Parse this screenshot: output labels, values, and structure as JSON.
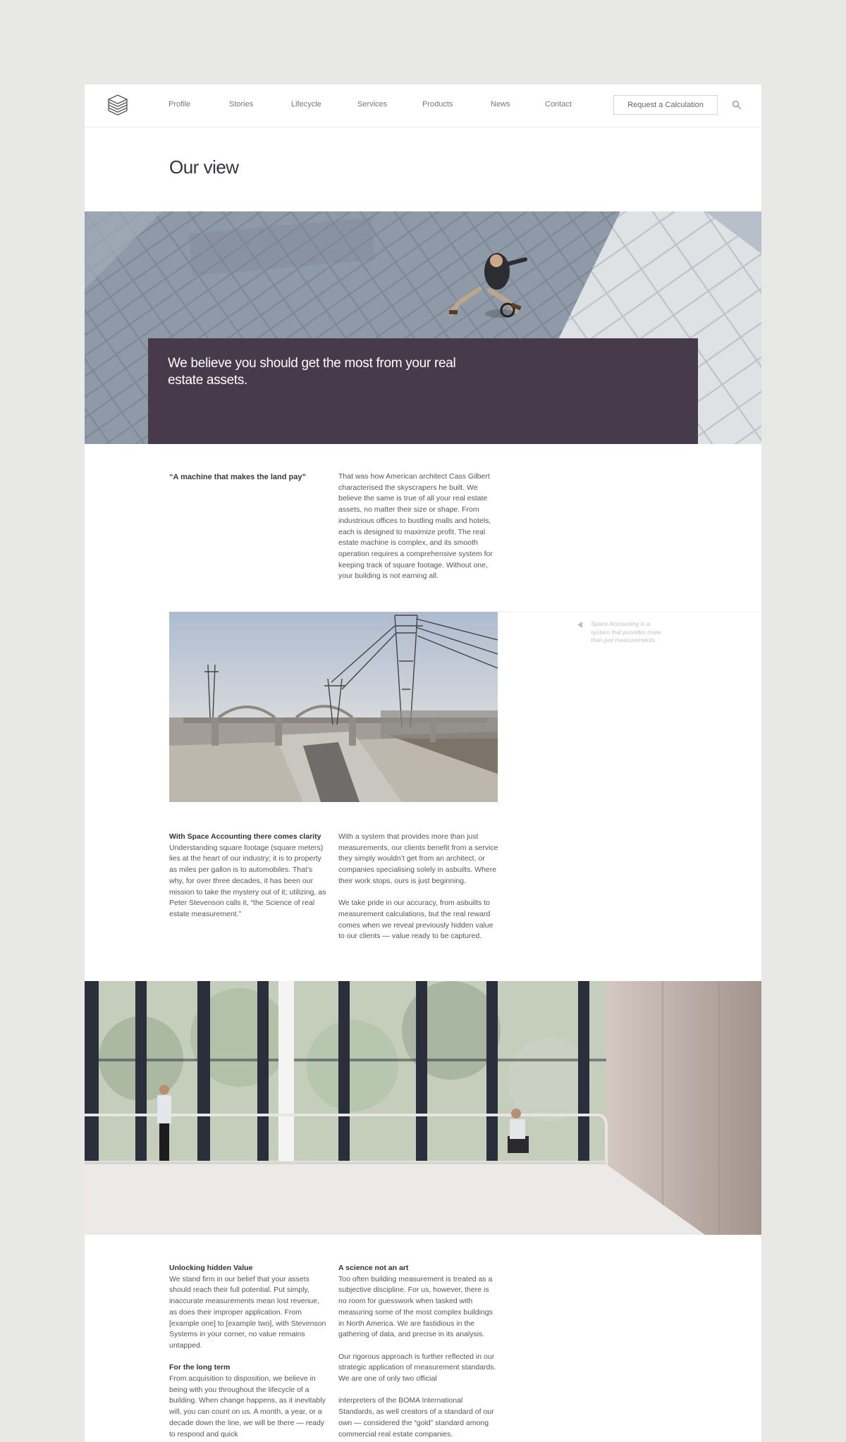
{
  "nav": {
    "links": [
      "Profile",
      "Stories",
      "Lifecycle",
      "Services",
      "Products",
      "News",
      "Contact"
    ],
    "cta_label": "Request a Calculation",
    "logo_icon": "stacked-layers-logo-icon",
    "search_icon": "search-icon"
  },
  "page": {
    "title": "Our view"
  },
  "hero": {
    "quote": "We believe you should get the most from your real estate assets."
  },
  "intro": {
    "lead": "“A machine that makes the land pay”",
    "body": "That was how American architect Cass Gilbert characterised the skyscrapers he built. We believe the same is true of all your real estate assets, no matter their size or shape. From industrious offices to bustling malls and hotels, each is designed to maximize profit. The real estate machine is complex, and its smooth operation requires a comprehensive system for keeping track of square footage. Without one, your building is not earning all."
  },
  "aside": {
    "caption": "Space Accounting is a system that provides more than just measurements."
  },
  "clarity": {
    "heading": "With Space Accounting there comes clarity",
    "col1": "Understanding square footage (square meters) lies at the heart of our industry; it is to property as miles per gallon is to automobiles. That’s why, for over three decades, it has been our mission to take the mystery out of it; utilizing, as Peter Stevenson calls it, “the Science of real estate measurement.”",
    "col2_p1": "With a system that provides more than just measurements, our clients benefit from a service they simply wouldn’t get from an architect, or companies specialising solely in asbuilts. Where their work stops, ours is just beginning.",
    "col2_p2": "We take pride in our accuracy, from asbuilts to measurement calculations, but the real reward comes when we reveal previously hidden value to our clients — value ready to be captured."
  },
  "value": {
    "heading1": "Unlocking hidden Value",
    "body1": "We stand firm in our belief that your assets should reach their full potential. Put simply, inaccurate measurements mean lost revenue, as does their improper application. From [example one] to [example two], with Stevenson Systems in your corner, no value remains untapped.",
    "heading2": "For the long term",
    "body2": "From acquisition to disposition, we believe in being with you throughout the lifecycle of a building. When change happens, as it inevitably will, you can count on us. A month, a year, or a decade down the line, we will be there — ready to respond and quick",
    "heading3": "A science not an art",
    "body3": "Too often building measurement is treated as a subjective discipline. For us, however, there is no room for guesswork when tasked with measuring some of the most complex buildings in North America. We are fastidious in the gathering of data, and precise in its analysis.",
    "body4": "Our rigorous approach is further reflected in our strategic application of measurement standards. We are one of only two official",
    "body5": "interpreters of the BOMA International Standards, as well creators of a standard of our own — considered the “gold” standard among commercial real estate companies."
  }
}
